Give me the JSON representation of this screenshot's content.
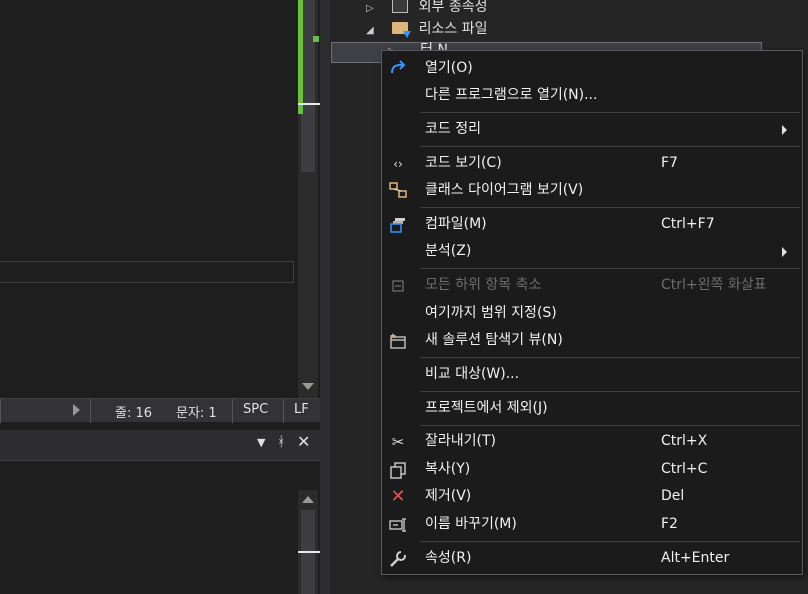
{
  "status_bar": {
    "line": "줄: 16",
    "char": "문자: 1",
    "spc": "SPC",
    "lf": "LF"
  },
  "panel": {
    "dropdown_icon": "chevron-down-icon",
    "pin_icon": "pin-icon",
    "close_icon": "close-icon"
  },
  "tree": {
    "items": [
      {
        "label": "외부 종속성",
        "icon": "external-deps-icon"
      },
      {
        "label": "리소스 파일",
        "icon": "filter-folder-icon"
      },
      {
        "label": "터 N",
        "icon": "file-icon"
      }
    ]
  },
  "context_menu": {
    "items": [
      {
        "label": "열기(O)",
        "shortcut": "",
        "icon": "redo-arrow-icon"
      },
      {
        "label": "다른 프로그램으로 열기(N)...",
        "shortcut": "",
        "icon": ""
      },
      {
        "label": "코드 정리",
        "shortcut": "",
        "icon": "",
        "submenu": true
      },
      {
        "label": "코드 보기(C)",
        "shortcut": "F7",
        "icon": "code-icon"
      },
      {
        "label": "클래스 다이어그램 보기(V)",
        "shortcut": "",
        "icon": "class-diagram-icon"
      },
      {
        "label": "컴파일(M)",
        "shortcut": "Ctrl+F7",
        "icon": "compile-icon"
      },
      {
        "label": "분석(Z)",
        "shortcut": "",
        "icon": "",
        "submenu": true
      },
      {
        "label": "모든 하위 항목 축소",
        "shortcut": "Ctrl+왼쪽 화살표",
        "icon": "collapse-icon",
        "disabled": true
      },
      {
        "label": "여기까지 범위 지정(S)",
        "shortcut": "",
        "icon": ""
      },
      {
        "label": "새 솔루션 탐색기 뷰(N)",
        "shortcut": "",
        "icon": "new-view-icon"
      },
      {
        "label": "비교 대상(W)...",
        "shortcut": "",
        "icon": ""
      },
      {
        "label": "프로젝트에서 제외(J)",
        "shortcut": "",
        "icon": ""
      },
      {
        "label": "잘라내기(T)",
        "shortcut": "Ctrl+X",
        "icon": "scissors-icon"
      },
      {
        "label": "복사(Y)",
        "shortcut": "Ctrl+C",
        "icon": "copy-icon"
      },
      {
        "label": "제거(V)",
        "shortcut": "Del",
        "icon": "delete-x-icon",
        "color": "#e05252"
      },
      {
        "label": "이름 바꾸기(M)",
        "shortcut": "F2",
        "icon": "rename-icon"
      },
      {
        "label": "속성(R)",
        "shortcut": "Alt+Enter",
        "icon": "wrench-icon"
      }
    ]
  },
  "colors": {
    "accent_blue": "#3794ff",
    "change_green": "#6abf40",
    "delete_red": "#e05252",
    "folder_yellow": "#dcb67a"
  }
}
